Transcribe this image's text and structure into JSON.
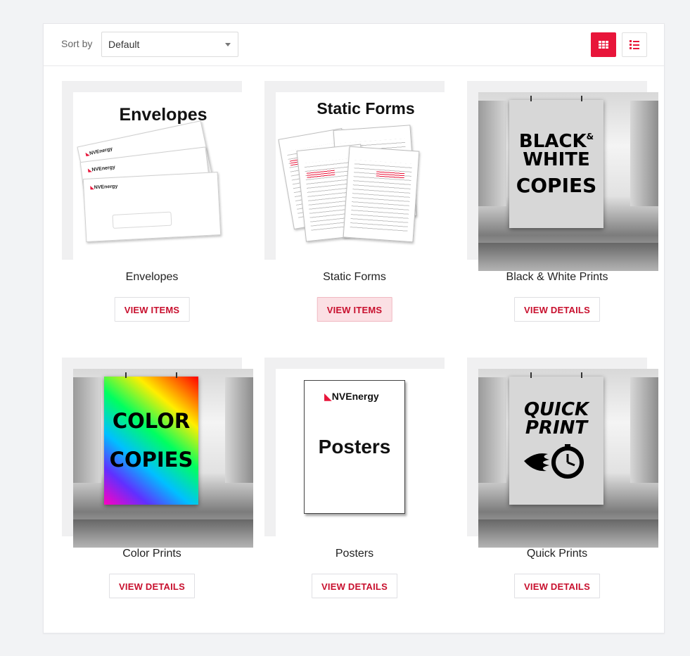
{
  "toolbar": {
    "sort_label": "Sort by",
    "sort_value": "Default",
    "grid_view": "grid-view",
    "list_view": "list-view"
  },
  "colors": {
    "accent": "#e8153a",
    "button_text": "#c8102e",
    "highlight_bg": "#fbe0e4"
  },
  "products": [
    {
      "title": "Envelopes",
      "button": "VIEW ITEMS",
      "thumb_text": "Envelopes",
      "logo": "NVEnergy"
    },
    {
      "title": "Static Forms",
      "button": "VIEW ITEMS",
      "thumb_text": "Static Forms"
    },
    {
      "title": "Black & White Prints",
      "button": "VIEW DETAILS",
      "thumb_text_1": "BLACK",
      "thumb_text_amp": "&",
      "thumb_text_2": "WHITE",
      "thumb_text_3": "COPIES"
    },
    {
      "title": "Color Prints",
      "button": "VIEW DETAILS",
      "thumb_text_1": "COLOR",
      "thumb_text_2": "COPIES"
    },
    {
      "title": "Posters",
      "button": "VIEW DETAILS",
      "thumb_text": "Posters",
      "logo": "NVEnergy"
    },
    {
      "title": "Quick Prints",
      "button": "VIEW DETAILS",
      "thumb_text_1": "QUICK",
      "thumb_text_2": "PRINT"
    }
  ]
}
